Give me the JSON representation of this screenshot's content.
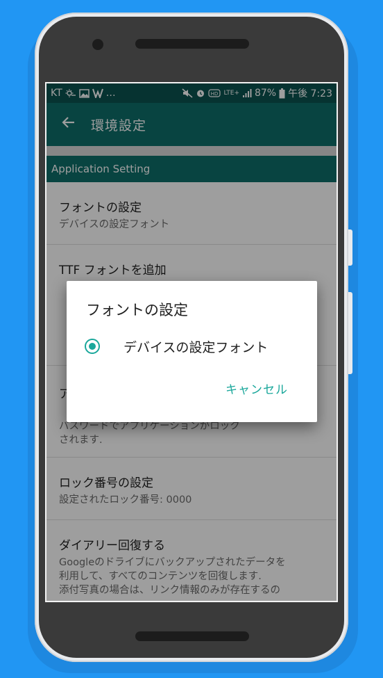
{
  "colors": {
    "background": "#2196f3",
    "status_bar": "#0b5350",
    "app_bar": "#0e6e6a",
    "accent": "#1aa79b"
  },
  "status_bar": {
    "carrier": "KT",
    "left_extra": "…",
    "network": "LTE+",
    "battery": "87%",
    "time": "午後 7:23"
  },
  "app_bar": {
    "back_icon": "arrow-left-icon",
    "title": "環境設定"
  },
  "section_header": "Application Setting",
  "settings": {
    "font": {
      "title": "フォントの設定",
      "summary": "デバイスの設定フォント"
    },
    "ttf": {
      "title": "TTF フォントを追加"
    },
    "app_lock": {
      "title": "ア",
      "summary_fragment": "パスワードでアプリケーションがロック",
      "summary_tail": "されます."
    },
    "lock_number": {
      "title": "ロック番号の設定",
      "summary": "設定されたロック番号: 0000"
    },
    "restore": {
      "title": "ダイアリー回復する",
      "summary_lines": [
        "Googleのドライブにバックアップされたデータを",
        "利用して、すべてのコンテンツを回復します.",
        "添付写真の場合は、リンク情報のみが存在するの"
      ]
    }
  },
  "dialog": {
    "title": "フォントの設定",
    "options": [
      {
        "label": "デバイスの設定フォント",
        "selected": true
      }
    ],
    "cancel_label": "キャンセル"
  }
}
